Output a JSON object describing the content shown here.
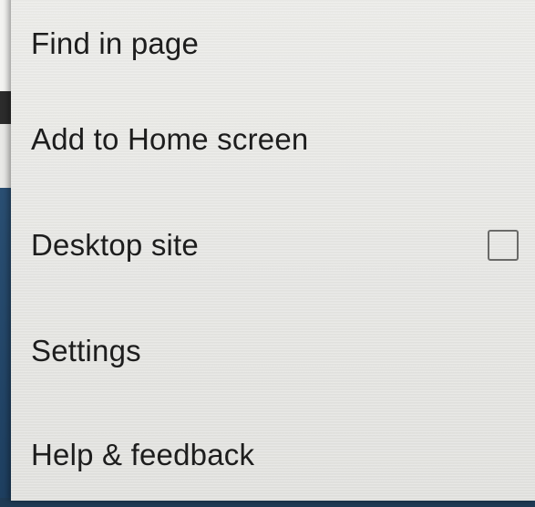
{
  "menu": {
    "items": [
      {
        "label": "Find in page"
      },
      {
        "label": "Add to Home screen"
      },
      {
        "label": "Desktop site",
        "checked": false
      },
      {
        "label": "Settings"
      },
      {
        "label": "Help & feedback"
      }
    ]
  },
  "colors": {
    "menu_background": "#e6e6e3",
    "text": "#1d1d1d",
    "checkbox_border": "#6a6a68",
    "backdrop": "#1f3b55"
  }
}
